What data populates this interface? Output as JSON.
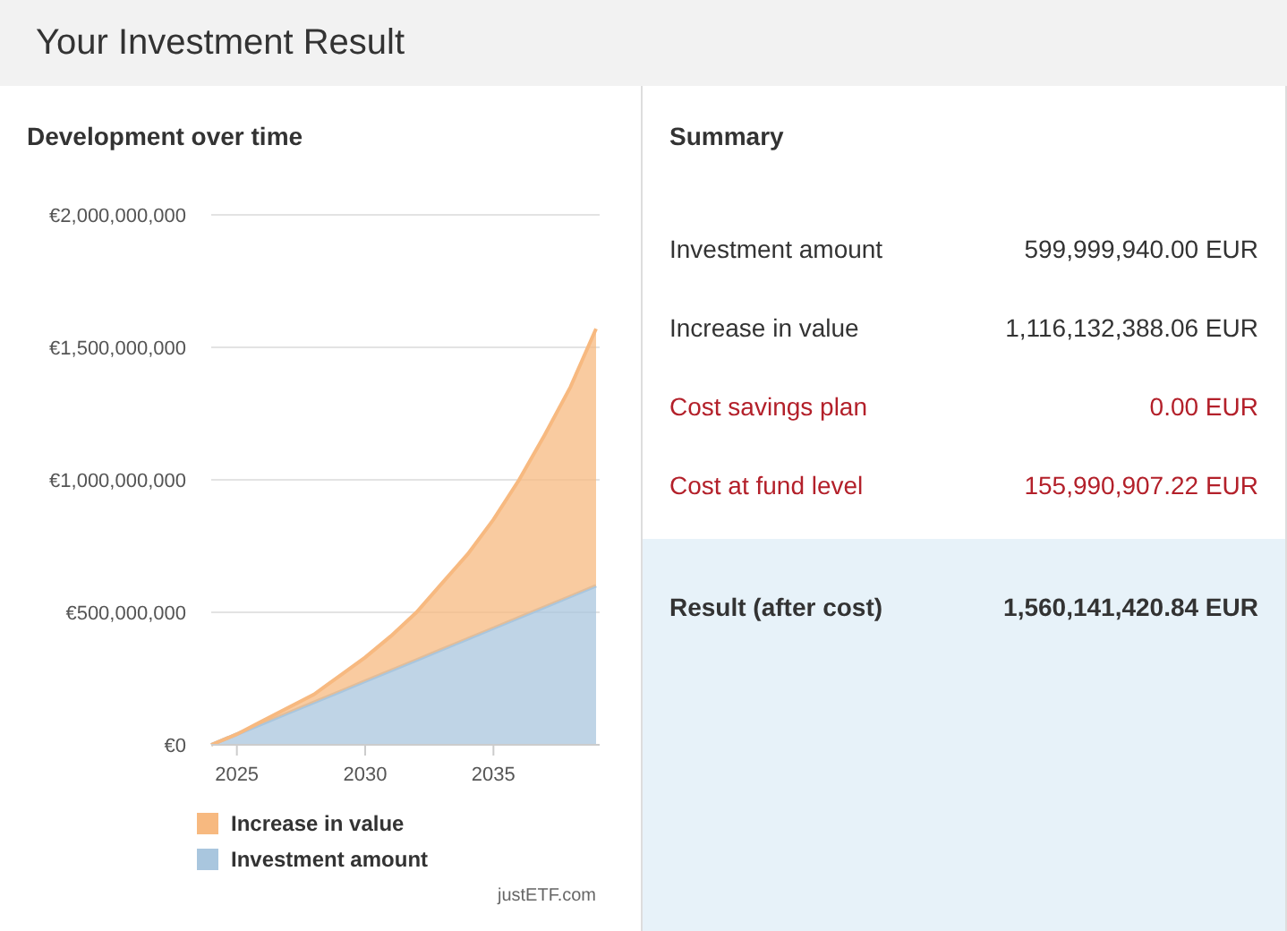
{
  "header": {
    "title": "Your Investment Result"
  },
  "development": {
    "title": "Development over time",
    "chart_data": {
      "type": "area",
      "stacked": true,
      "x": [
        2024,
        2025,
        2026,
        2027,
        2028,
        2029,
        2030,
        2031,
        2032,
        2033,
        2034,
        2035,
        2036,
        2037,
        2038,
        2039
      ],
      "xlim": [
        2024,
        2039
      ],
      "ylim": [
        0,
        2000000000
      ],
      "xticks": [
        2025,
        2030,
        2035
      ],
      "yticks": [
        {
          "value": 0,
          "label": "€0"
        },
        {
          "value": 500000000,
          "label": "€500,000,000"
        },
        {
          "value": 1000000000,
          "label": "€1,000,000,000"
        },
        {
          "value": 1500000000,
          "label": "€1,500,000,000"
        },
        {
          "value": 2000000000,
          "label": "€2,000,000,000"
        }
      ],
      "series": [
        {
          "name": "Investment amount",
          "color": "#a9c6de",
          "values": [
            0,
            40000000,
            80000000,
            120000000,
            160000000,
            200000000,
            240000000,
            280000000,
            320000000,
            360000000,
            400000000,
            440000000,
            480000000,
            520000000,
            560000000,
            600000000
          ]
        },
        {
          "name": "Increase in value",
          "color": "#f7b980",
          "values": [
            0,
            0,
            10000000,
            20000000,
            30000000,
            60000000,
            90000000,
            130000000,
            180000000,
            250000000,
            320000000,
            410000000,
            520000000,
            650000000,
            790000000,
            970000000
          ]
        }
      ],
      "grid": true
    },
    "credit": "justETF.com"
  },
  "summary": {
    "title": "Summary",
    "rows": [
      {
        "label": "Investment amount",
        "value": "599,999,940.00 EUR",
        "kind": "plain"
      },
      {
        "label": "Increase in value",
        "value": "1,116,132,388.06 EUR",
        "kind": "plain"
      },
      {
        "label": "Cost savings plan",
        "value": "0.00 EUR",
        "kind": "cost"
      },
      {
        "label": "Cost at fund level",
        "value": "155,990,907.22 EUR",
        "kind": "cost"
      }
    ],
    "result": {
      "label": "Result (after cost)",
      "value": "1,560,141,420.84 EUR"
    }
  }
}
